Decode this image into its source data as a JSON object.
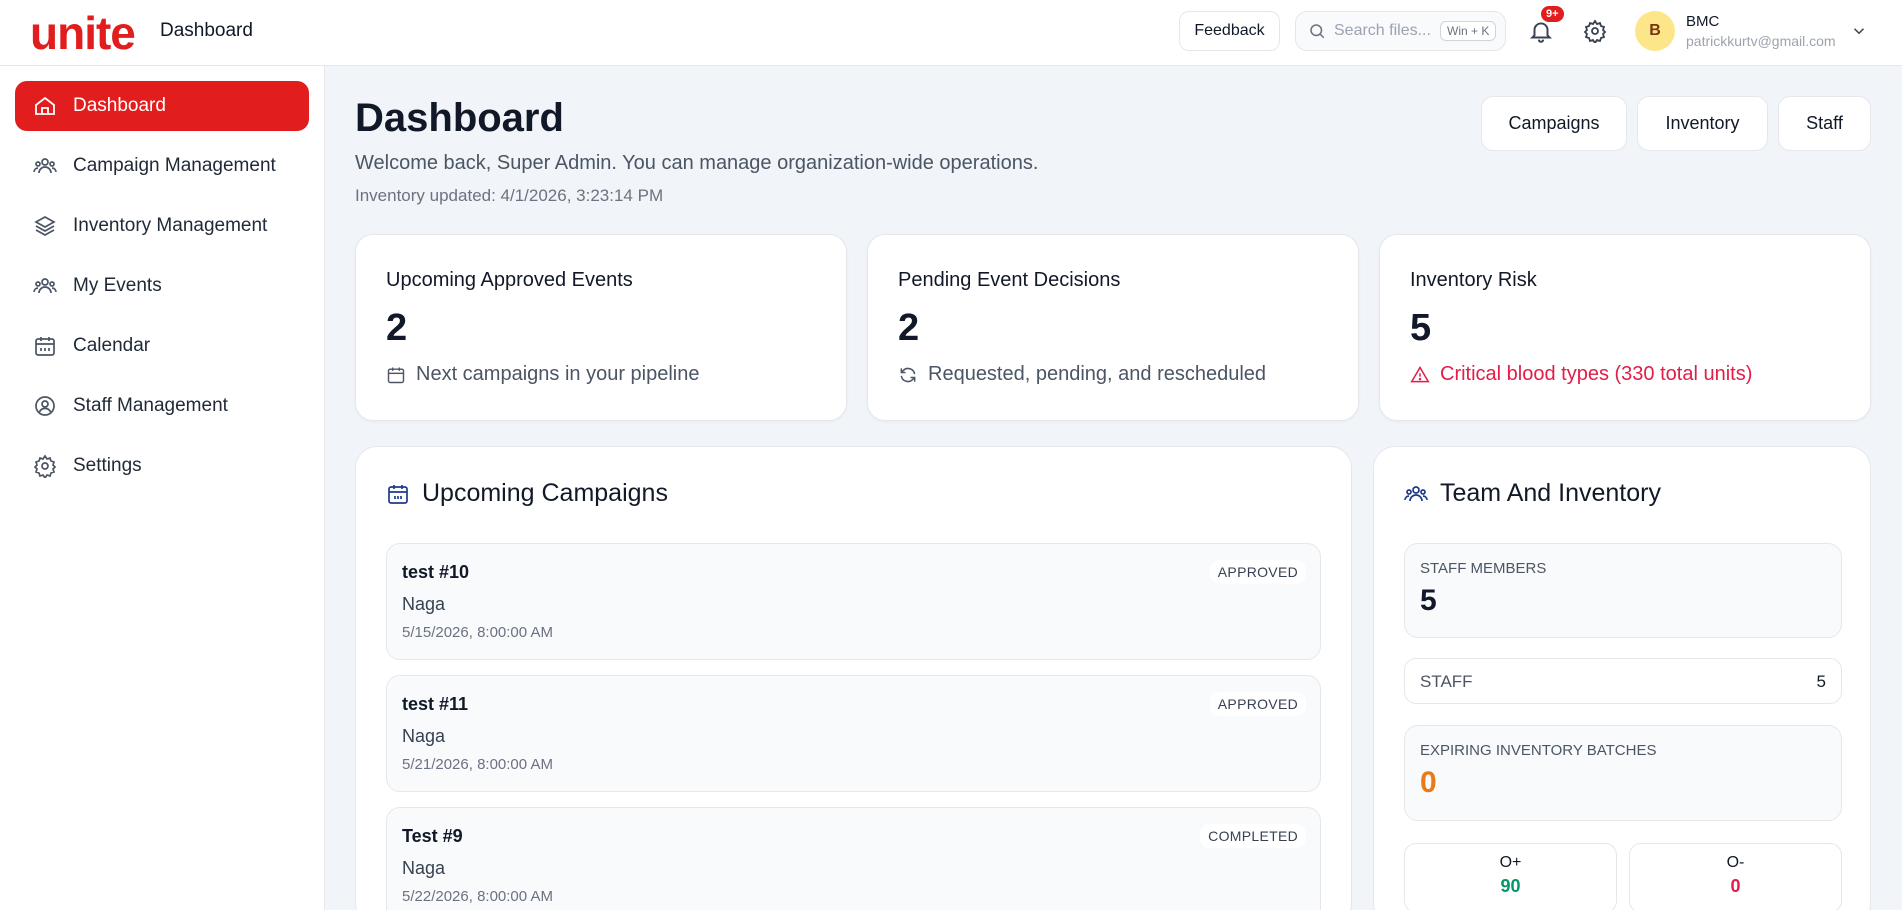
{
  "app": {
    "logo": "unite",
    "page": "Dashboard"
  },
  "topbar": {
    "feedback_label": "Feedback",
    "search_placeholder": "Search files...",
    "search_shortcut": "Win + K",
    "notif_badge": "9+",
    "user_initial": "B",
    "user_name": "BMC",
    "user_email": "patrickkurtv@gmail.com"
  },
  "sidebar": {
    "items": [
      {
        "label": "Dashboard",
        "icon": "home-icon",
        "active": true
      },
      {
        "label": "Campaign Management",
        "icon": "users-icon"
      },
      {
        "label": "Inventory Management",
        "icon": "layers-icon"
      },
      {
        "label": "My Events",
        "icon": "users-icon"
      },
      {
        "label": "Calendar",
        "icon": "calendar-icon"
      },
      {
        "label": "Staff Management",
        "icon": "user-circle-icon"
      },
      {
        "label": "Settings",
        "icon": "gear-icon"
      }
    ]
  },
  "header": {
    "title": "Dashboard",
    "subtitle": "Welcome back, Super Admin. You can manage organization-wide operations.",
    "updated": "Inventory updated: 4/1/2026, 3:23:14 PM",
    "buttons": [
      "Campaigns",
      "Inventory",
      "Staff"
    ]
  },
  "stats": [
    {
      "title": "Upcoming Approved Events",
      "value": "2",
      "note": "Next campaigns in your pipeline",
      "icon": "calendar-icon"
    },
    {
      "title": "Pending Event Decisions",
      "value": "2",
      "note": "Requested, pending, and rescheduled",
      "icon": "refresh-icon"
    },
    {
      "title": "Inventory Risk",
      "value": "5",
      "note": "Critical blood types (330 total units)",
      "icon": "warning-icon"
    }
  ],
  "campaigns": {
    "title": "Upcoming Campaigns",
    "items": [
      {
        "name": "test #10",
        "location": "Naga",
        "date": "5/15/2026, 8:00:00 AM",
        "status": "APPROVED"
      },
      {
        "name": "test #11",
        "location": "Naga",
        "date": "5/21/2026, 8:00:00 AM",
        "status": "APPROVED"
      },
      {
        "name": "Test #9",
        "location": "Naga",
        "date": "5/22/2026, 8:00:00 AM",
        "status": "COMPLETED"
      }
    ]
  },
  "team": {
    "title": "Team And Inventory",
    "staff_members_label": "STAFF MEMBERS",
    "staff_members_value": "5",
    "staff_label": "STAFF",
    "staff_value": "5",
    "expiring_label": "EXPIRING INVENTORY BATCHES",
    "expiring_value": "0",
    "blood": [
      {
        "type": "O+",
        "value": "90",
        "color": "#059669"
      },
      {
        "type": "O-",
        "value": "0",
        "color": "#e11d48"
      }
    ]
  },
  "colors": {
    "brand": "#e11d1d",
    "danger": "#e11d48",
    "warning": "#ea7a16",
    "success": "#059669"
  }
}
